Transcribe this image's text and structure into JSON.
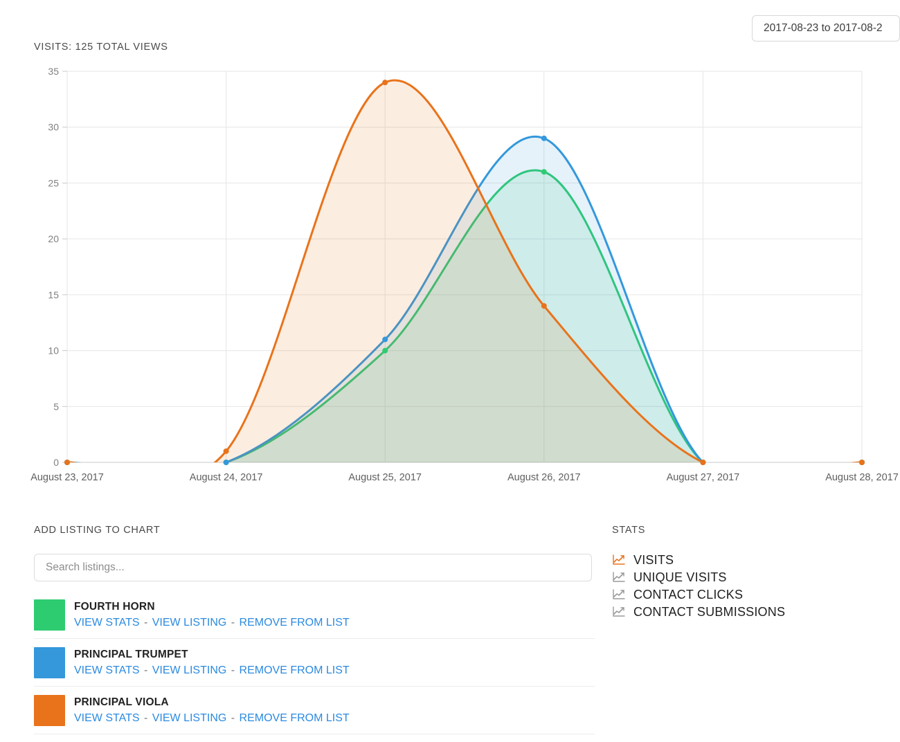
{
  "header": {
    "date_range_label": "2017-08-23 to 2017-08-2"
  },
  "chart": {
    "title": "VISITS: 125 TOTAL VIEWS"
  },
  "chart_data": {
    "type": "area",
    "title": "VISITS: 125 TOTAL VIEWS",
    "xlabel": "",
    "ylabel": "",
    "x": [
      "August 23, 2017",
      "August 24, 2017",
      "August 25, 2017",
      "August 26, 2017",
      "August 27, 2017",
      "August 28, 2017"
    ],
    "categories": [
      "August 23, 2017",
      "August 24, 2017",
      "August 25, 2017",
      "August 26, 2017",
      "August 27, 2017",
      "August 28, 2017"
    ],
    "yticks": [
      0,
      5,
      10,
      15,
      20,
      25,
      30,
      35
    ],
    "ylim": [
      0,
      35
    ],
    "grid": true,
    "legend_position": "below-chart-as-listing-rows",
    "interpolation": "smooth",
    "series": [
      {
        "name": "FOURTH HORN",
        "color": "#2ecc71",
        "fill": "#2ecc71",
        "values": [
          0,
          0,
          10,
          26,
          0,
          0
        ]
      },
      {
        "name": "PRINCIPAL TRUMPET",
        "color": "#3498db",
        "fill": "#3498db",
        "values": [
          0,
          0,
          11,
          29,
          0,
          0
        ]
      },
      {
        "name": "PRINCIPAL VIOLA",
        "color": "#e8731b",
        "fill": "#e8731b",
        "values": [
          0,
          1,
          34,
          14,
          0,
          0
        ]
      }
    ]
  },
  "add_listing": {
    "heading": "ADD LISTING TO CHART",
    "search_placeholder": "Search listings...",
    "search_value": "",
    "listings": [
      {
        "name": "FOURTH HORN",
        "color": "#2ecc71",
        "links": {
          "view_stats": "VIEW STATS",
          "view_listing": "VIEW LISTING",
          "remove": "REMOVE FROM LIST"
        }
      },
      {
        "name": "PRINCIPAL TRUMPET",
        "color": "#3498db",
        "links": {
          "view_stats": "VIEW STATS",
          "view_listing": "VIEW LISTING",
          "remove": "REMOVE FROM LIST"
        }
      },
      {
        "name": "PRINCIPAL VIOLA",
        "color": "#e8731b",
        "links": {
          "view_stats": "VIEW STATS",
          "view_listing": "VIEW LISTING",
          "remove": "REMOVE FROM LIST"
        }
      }
    ],
    "link_separator": "-"
  },
  "stats": {
    "heading": "STATS",
    "active_color": "#e8731b",
    "inactive_color": "#9a9a9a",
    "items": [
      {
        "label": "VISITS",
        "icon": "line-chart-icon",
        "active": true
      },
      {
        "label": "UNIQUE VISITS",
        "icon": "line-chart-icon",
        "active": false
      },
      {
        "label": "CONTACT CLICKS",
        "icon": "line-chart-icon",
        "active": false
      },
      {
        "label": "CONTACT SUBMISSIONS",
        "icon": "line-chart-icon",
        "active": false
      }
    ]
  }
}
